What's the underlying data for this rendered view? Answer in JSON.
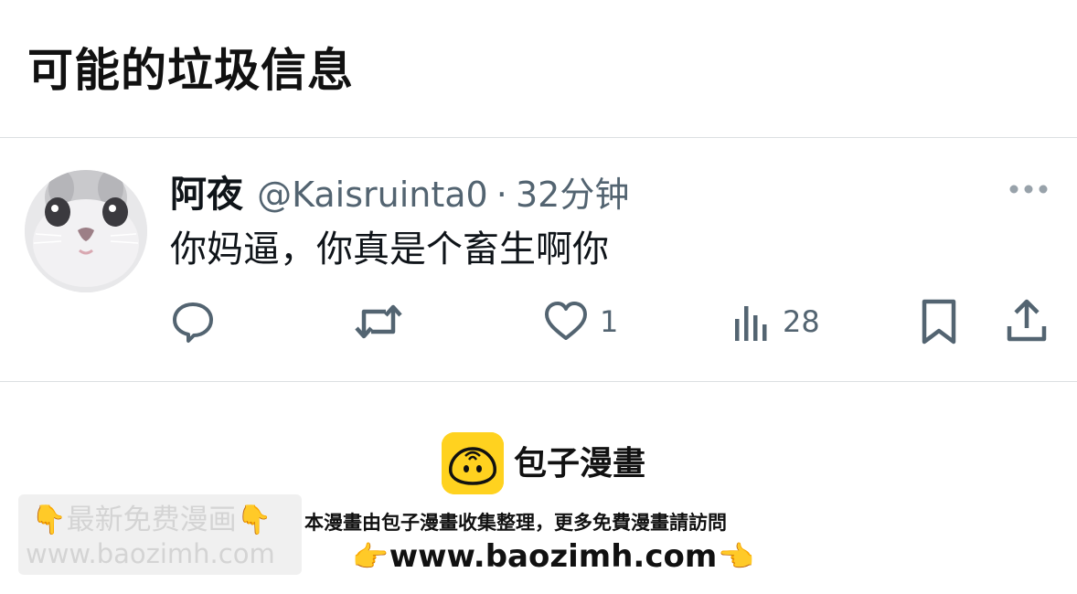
{
  "section": {
    "title": "可能的垃圾信息"
  },
  "tweet": {
    "display_name": "阿夜",
    "handle": "@Kaisruinta0",
    "separator": "·",
    "time": "32分钟",
    "text": "你妈逼，你真是个畜生啊你",
    "avatar_icon": "cat-avatar",
    "actions": {
      "reply": {
        "icon": "reply-icon"
      },
      "retweet": {
        "icon": "retweet-icon"
      },
      "like": {
        "icon": "heart-icon",
        "count": "1"
      },
      "views": {
        "icon": "views-icon",
        "count": "28"
      },
      "bookmark": {
        "icon": "bookmark-icon"
      },
      "share": {
        "icon": "share-icon"
      }
    },
    "more_icon": "more-icon"
  },
  "brand": {
    "name": "包子漫畫",
    "logo_icon": "bun-logo",
    "accent": "#ffd21f",
    "notice": "本漫畫由包子漫畫收集整理，更多免費漫畫請訪問",
    "url": "www.baozimh.com",
    "left_hand": "👉",
    "right_hand": "👈"
  },
  "watermark": {
    "title": "👇最新免费漫画👇",
    "url": "www.baozimh.com"
  },
  "colors": {
    "text_primary": "#0f1419",
    "text_secondary": "#536471",
    "divider": "#dcdfe2"
  }
}
